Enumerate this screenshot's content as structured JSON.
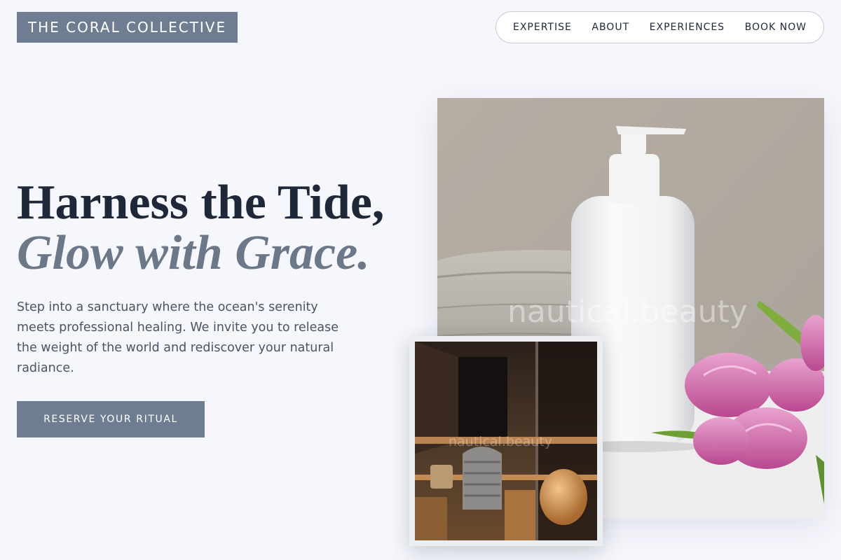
{
  "brand": {
    "name": "THE CORAL COLLECTIVE"
  },
  "nav": {
    "items": [
      {
        "label": "EXPERTISE"
      },
      {
        "label": "ABOUT"
      },
      {
        "label": "EXPERIENCES"
      },
      {
        "label": "BOOK NOW"
      }
    ]
  },
  "hero": {
    "headline_line1": "Harness the Tide,",
    "headline_line2": "Glow with Grace.",
    "intro": "Step into a sanctuary where the ocean's serenity meets professional healing. We invite you to release the weight of the world and rediscover your natural radiance.",
    "cta_label": "RESERVE YOUR RITUAL"
  },
  "images": {
    "main_watermark": "nautical.beauty",
    "inset_watermark": "nautical.beauty"
  },
  "colors": {
    "page_background": "#f6f7fd",
    "accent_slate": "#6e7d91",
    "headline_dark": "#1e2838",
    "headline_italic": "#6a7889",
    "body_text": "#4a5463"
  }
}
